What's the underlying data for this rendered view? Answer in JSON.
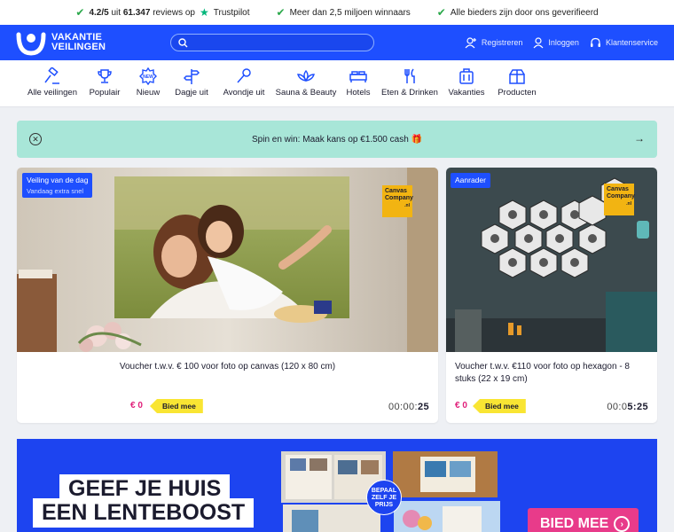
{
  "usps": [
    {
      "rating": "4.2/5",
      "mid": "uit",
      "count": "61.347",
      "suffix": "reviews op",
      "brand": "Trustpilot"
    },
    {
      "text": "Meer dan 2,5 miljoen winnaars"
    },
    {
      "text": "Alle bieders zijn door ons geverifieerd"
    }
  ],
  "header": {
    "logo_line1": "VAKANTIE",
    "logo_line2": "VEILINGEN",
    "search_placeholder": "",
    "register": "Registreren",
    "login": "Inloggen",
    "service": "Klantenservice"
  },
  "nav": [
    {
      "label": "Alle veilingen",
      "icon": "gavel-icon"
    },
    {
      "label": "Populair",
      "icon": "trophy-icon"
    },
    {
      "label": "Nieuw",
      "icon": "new-badge-icon"
    },
    {
      "label": "Dagje uit",
      "icon": "signpost-icon"
    },
    {
      "label": "Avondje uit",
      "icon": "microphone-icon"
    },
    {
      "label": "Sauna & Beauty",
      "icon": "lotus-icon"
    },
    {
      "label": "Hotels",
      "icon": "bed-icon"
    },
    {
      "label": "Eten & Drinken",
      "icon": "cutlery-icon"
    },
    {
      "label": "Vakanties",
      "icon": "suitcase-icon"
    },
    {
      "label": "Producten",
      "icon": "gift-box-icon"
    }
  ],
  "spin_banner": {
    "text": "Spin en win: Maak kans op €1.500 cash 🎁",
    "arrow": "→"
  },
  "cards": [
    {
      "badge": "Veiling van de dag",
      "badge_sub": "Vandaag extra snel",
      "title": "Voucher t.w.v. € 100 voor foto op canvas (120 x 80 cm)",
      "price": "€ 0",
      "bid": "Bied mee",
      "timer_dim": "00:00:",
      "timer_end": "25",
      "logo_top": "Canvas",
      "logo_mid": "Company",
      "logo_tld": ".nl"
    },
    {
      "badge": "Aanrader",
      "title": "Voucher t.w.v. €110 voor foto op hexagon - 8 stuks (22 x 19 cm)",
      "price": "€ 0",
      "bid": "Bied mee",
      "timer_dim": "00:0",
      "timer_end": "5:25",
      "logo_top": "Canvas",
      "logo_mid": "Company",
      "logo_tld": ".nl"
    }
  ],
  "promo": {
    "line1": "GEEF JE HUIS",
    "line2": "EEN LENTEBOOST",
    "bepaal": "BEPAAL ZELF JE PRIJS",
    "cta": "BIED MEE"
  },
  "colors": {
    "brand_blue": "#1e4fff",
    "accent_pink": "#e0207a",
    "bid_yellow": "#f9e533",
    "mint": "#a8e6d8"
  }
}
